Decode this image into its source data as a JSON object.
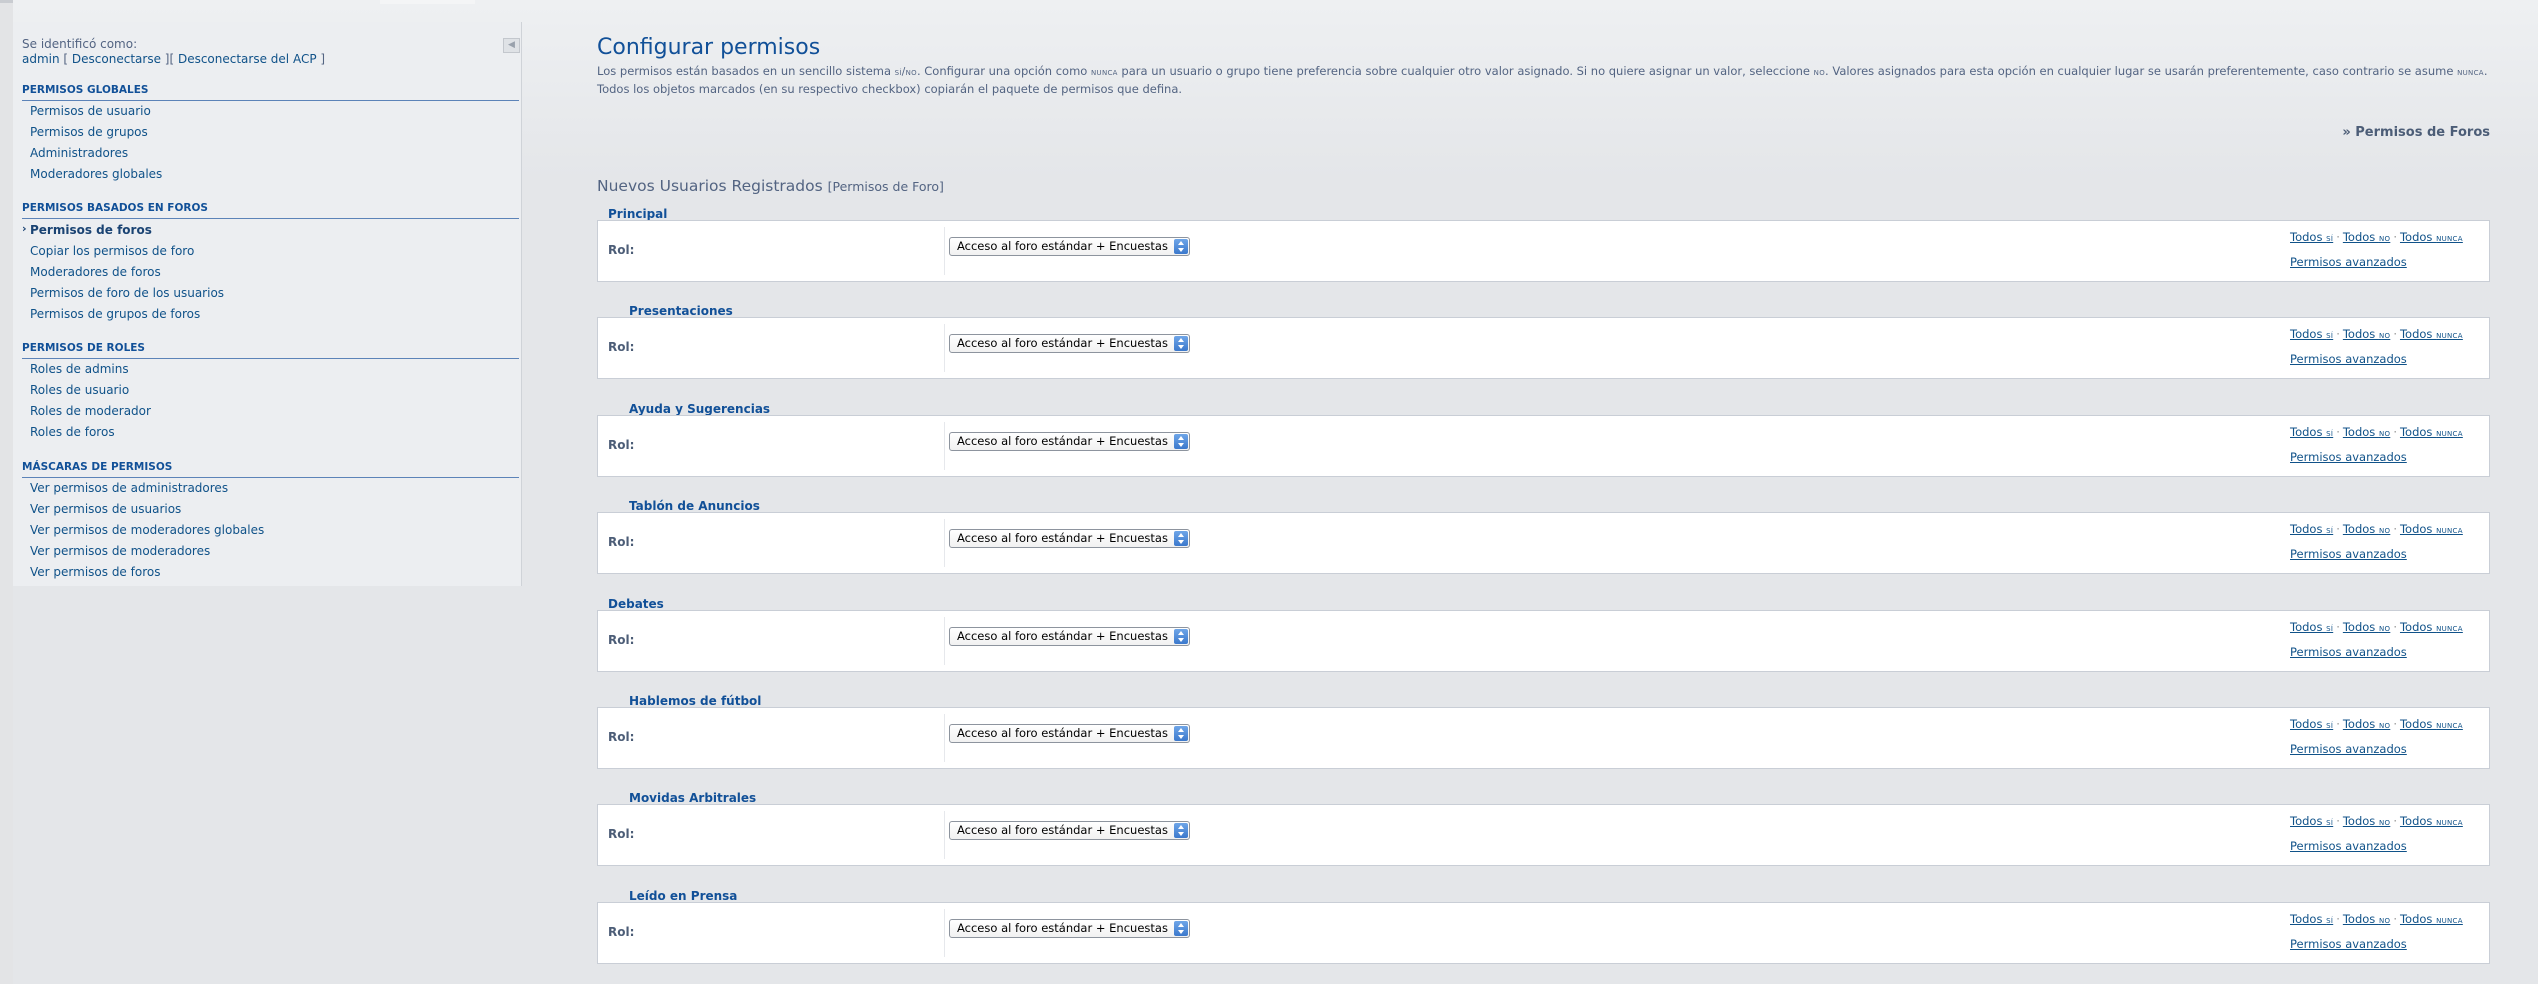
{
  "sidebar": {
    "login_label": "Se identificó como:",
    "user": "admin",
    "logout": "Desconectarse",
    "logout_acp": "Desconectarse del ACP",
    "sections": [
      {
        "title": "PERMISOS GLOBALES",
        "items": [
          "Permisos de usuario",
          "Permisos de grupos",
          "Administradores",
          "Moderadores globales"
        ]
      },
      {
        "title": "PERMISOS BASADOS EN FOROS",
        "items": [
          "Permisos de foros",
          "Copiar los permisos de foro",
          "Moderadores de foros",
          "Permisos de foro de los usuarios",
          "Permisos de grupos de foros"
        ]
      },
      {
        "title": "PERMISOS DE ROLES",
        "items": [
          "Roles de admins",
          "Roles de usuario",
          "Roles de moderador",
          "Roles de foros"
        ]
      },
      {
        "title": "MÁSCARAS DE PERMISOS",
        "items": [
          "Ver permisos de administradores",
          "Ver permisos de usuarios",
          "Ver permisos de moderadores globales",
          "Ver permisos de moderadores",
          "Ver permisos de foros"
        ]
      }
    ]
  },
  "main": {
    "title": "Configurar permisos",
    "intro": {
      "p1": "Los permisos están basados en un sencillo sistema ",
      "yesno": "sí/no",
      "p2": ". Configurar una opción como ",
      "never": "nunca",
      "p3": " para un usuario o grupo tiene preferencia sobre cualquier otro valor asignado. Si no quiere asignar un valor, seleccione ",
      "no": "no",
      "p4": ". Valores asignados para esta opción en cualquier lugar se usarán preferentemente, caso contrario se asume ",
      "never2": "nunca",
      "p5": ".",
      "line2": "Todos los objetos marcados (en su respectivo checkbox) copiarán el paquete de permisos que defina."
    },
    "forum_permissions_link": "» Permisos de Foros",
    "group_heading": "Nuevos Usuarios Registrados",
    "group_heading_sub": "[Permisos de Foro]",
    "role_label": "Rol:",
    "role_value": "Acceso al foro estándar + Encuestas",
    "all_yes_prefix": "Todos ",
    "all_yes": "sí",
    "all_no_prefix": "Todos ",
    "all_no": "no",
    "all_never_prefix": "Todos ",
    "all_never": "nunca",
    "separator": "·",
    "advanced": "Permisos avanzados",
    "forums": [
      "Principal",
      "Presentaciones",
      "Ayuda y Sugerencias",
      "Tablón de Anuncios",
      "Debates",
      "Hablemos de fútbol",
      "Movidas Arbitrales",
      "Leído en Prensa"
    ]
  }
}
